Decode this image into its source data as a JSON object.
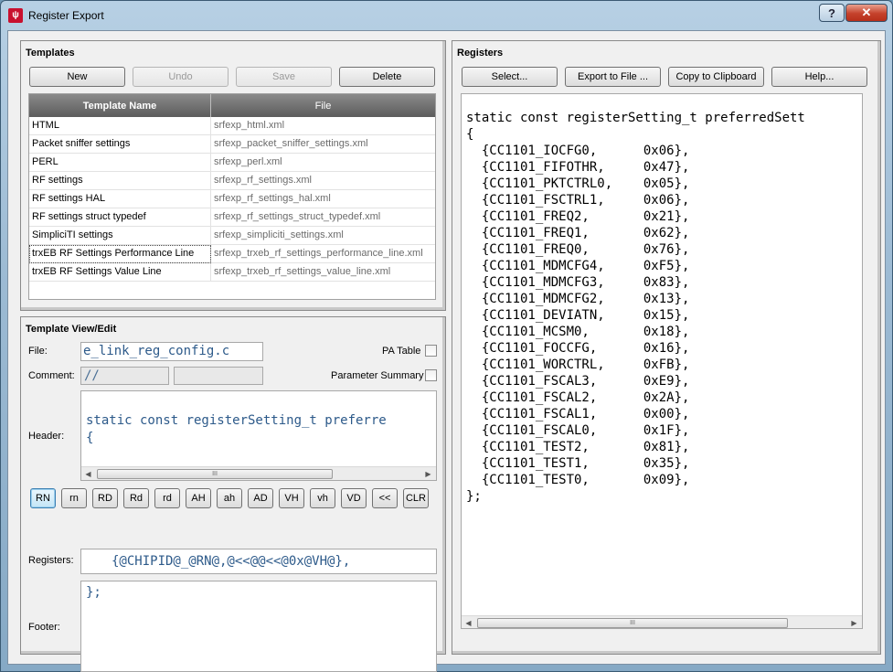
{
  "window": {
    "title": "Register Export",
    "help_glyph": "?",
    "close_glyph": "✕"
  },
  "templates": {
    "title": "Templates",
    "buttons": {
      "new": "New",
      "undo": "Undo",
      "save": "Save",
      "delete": "Delete"
    },
    "columns": {
      "name": "Template Name",
      "file": "File"
    },
    "rows": [
      {
        "name": "HTML",
        "file": "srfexp_html.xml"
      },
      {
        "name": "Packet sniffer settings",
        "file": "srfexp_packet_sniffer_settings.xml"
      },
      {
        "name": "PERL",
        "file": "srfexp_perl.xml"
      },
      {
        "name": "RF settings",
        "file": "srfexp_rf_settings.xml"
      },
      {
        "name": "RF settings HAL",
        "file": "srfexp_rf_settings_hal.xml"
      },
      {
        "name": "RF settings struct typedef",
        "file": "srfexp_rf_settings_struct_typedef.xml"
      },
      {
        "name": "SimpliciTI settings",
        "file": "srfexp_simpliciti_settings.xml"
      },
      {
        "name": "trxEB RF Settings Performance Line",
        "file": "srfexp_trxeb_rf_settings_performance_line.xml"
      },
      {
        "name": "trxEB RF Settings Value Line",
        "file": "srfexp_trxeb_rf_settings_value_line.xml"
      }
    ]
  },
  "template_view": {
    "title": "Template View/Edit",
    "file_label": "File:",
    "file_value": "e_link_reg_config.c",
    "pa_table_label": "PA Table",
    "comment_label": "Comment:",
    "comment_value": "//",
    "param_summary_label": "Parameter Summary",
    "header_label": "Header:",
    "header_lines": [
      "static const registerSetting_t preferre",
      "{"
    ],
    "token_buttons": [
      "RN",
      "rn",
      "RD",
      "Rd",
      "rd",
      "AH",
      "ah",
      "AD",
      "VH",
      "vh",
      "VD",
      "<<",
      "CLR"
    ],
    "registers_label": "Registers:",
    "registers_value": "{@CHIPID@_@RN@,@<<@@<<@0x@VH@},",
    "footer_label": "Footer:",
    "footer_value": "};"
  },
  "registers": {
    "title": "Registers",
    "buttons": {
      "select": "Select...",
      "export": "Export to File ...",
      "copy": "Copy to Clipboard",
      "help": "Help..."
    },
    "code_lines": [
      "static const registerSetting_t preferredSett",
      "{",
      "  {CC1101_IOCFG0,      0x06},",
      "  {CC1101_FIFOTHR,     0x47},",
      "  {CC1101_PKTCTRL0,    0x05},",
      "  {CC1101_FSCTRL1,     0x06},",
      "  {CC1101_FREQ2,       0x21},",
      "  {CC1101_FREQ1,       0x62},",
      "  {CC1101_FREQ0,       0x76},",
      "  {CC1101_MDMCFG4,     0xF5},",
      "  {CC1101_MDMCFG3,     0x83},",
      "  {CC1101_MDMCFG2,     0x13},",
      "  {CC1101_DEVIATN,     0x15},",
      "  {CC1101_MCSM0,       0x18},",
      "  {CC1101_FOCCFG,      0x16},",
      "  {CC1101_WORCTRL,     0xFB},",
      "  {CC1101_FSCAL3,      0xE9},",
      "  {CC1101_FSCAL2,      0x2A},",
      "  {CC1101_FSCAL1,      0x00},",
      "  {CC1101_FSCAL0,      0x1F},",
      "  {CC1101_TEST2,       0x81},",
      "  {CC1101_TEST1,       0x35},",
      "  {CC1101_TEST0,       0x09},",
      "};"
    ]
  },
  "scroll": {
    "left_arrow": "◀",
    "right_arrow": "▶",
    "thumb_grip": "III"
  }
}
